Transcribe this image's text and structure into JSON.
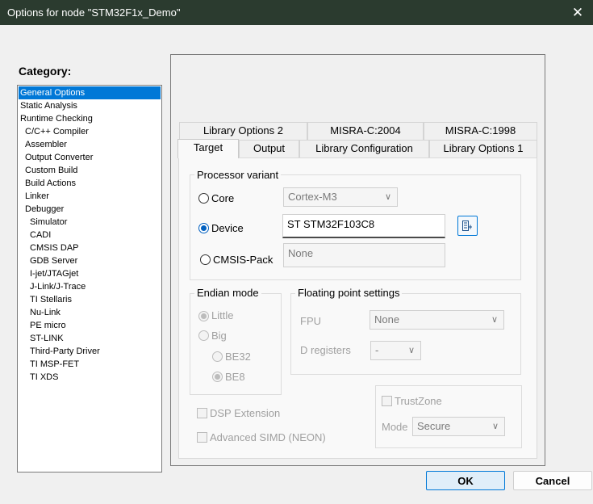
{
  "window": {
    "title": "Options for node \"STM32F1x_Demo\"",
    "close_glyph": "✕"
  },
  "category": {
    "label": "Category:",
    "items": [
      {
        "label": "General Options",
        "level": 0,
        "selected": true
      },
      {
        "label": "Static Analysis",
        "level": 0
      },
      {
        "label": "Runtime Checking",
        "level": 0
      },
      {
        "label": "C/C++ Compiler",
        "level": 1
      },
      {
        "label": "Assembler",
        "level": 1
      },
      {
        "label": "Output Converter",
        "level": 1
      },
      {
        "label": "Custom Build",
        "level": 1
      },
      {
        "label": "Build Actions",
        "level": 1
      },
      {
        "label": "Linker",
        "level": 1
      },
      {
        "label": "Debugger",
        "level": 1
      },
      {
        "label": "Simulator",
        "level": 2
      },
      {
        "label": "CADI",
        "level": 2
      },
      {
        "label": "CMSIS DAP",
        "level": 2
      },
      {
        "label": "GDB Server",
        "level": 2
      },
      {
        "label": "I-jet/JTAGjet",
        "level": 2
      },
      {
        "label": "J-Link/J-Trace",
        "level": 2
      },
      {
        "label": "TI Stellaris",
        "level": 2
      },
      {
        "label": "Nu-Link",
        "level": 2
      },
      {
        "label": "PE micro",
        "level": 2
      },
      {
        "label": "ST-LINK",
        "level": 2
      },
      {
        "label": "Third-Party Driver",
        "level": 2
      },
      {
        "label": "TI MSP-FET",
        "level": 2
      },
      {
        "label": "TI XDS",
        "level": 2
      }
    ]
  },
  "tabs": {
    "row_top": [
      "Library Options 2",
      "MISRA-C:2004",
      "MISRA-C:1998"
    ],
    "row_bottom": [
      "Target",
      "Output",
      "Library Configuration",
      "Library Options 1"
    ],
    "active": "Target"
  },
  "processor_variant": {
    "title": "Processor variant",
    "core_label": "Core",
    "core_value": "Cortex-M3",
    "device_label": "Device",
    "device_value": "ST STM32F103C8",
    "cmsis_label": "CMSIS-Pack",
    "cmsis_value": "None",
    "selected": "Device"
  },
  "endian_mode": {
    "title": "Endian mode",
    "little": "Little",
    "big": "Big",
    "be32": "BE32",
    "be8": "BE8"
  },
  "floating_point": {
    "title": "Floating point settings",
    "fpu_label": "FPU",
    "fpu_value": "None",
    "dreg_label": "D registers",
    "dreg_value": "-"
  },
  "extensions": {
    "dsp": "DSP Extension",
    "simd": "Advanced SIMD (NEON)"
  },
  "trustzone": {
    "label": "TrustZone",
    "mode_label": "Mode",
    "mode_value": "Secure"
  },
  "buttons": {
    "ok": "OK",
    "cancel": "Cancel"
  },
  "colors": {
    "selection": "#0078d7",
    "titlebar": "#2b3b2f"
  }
}
